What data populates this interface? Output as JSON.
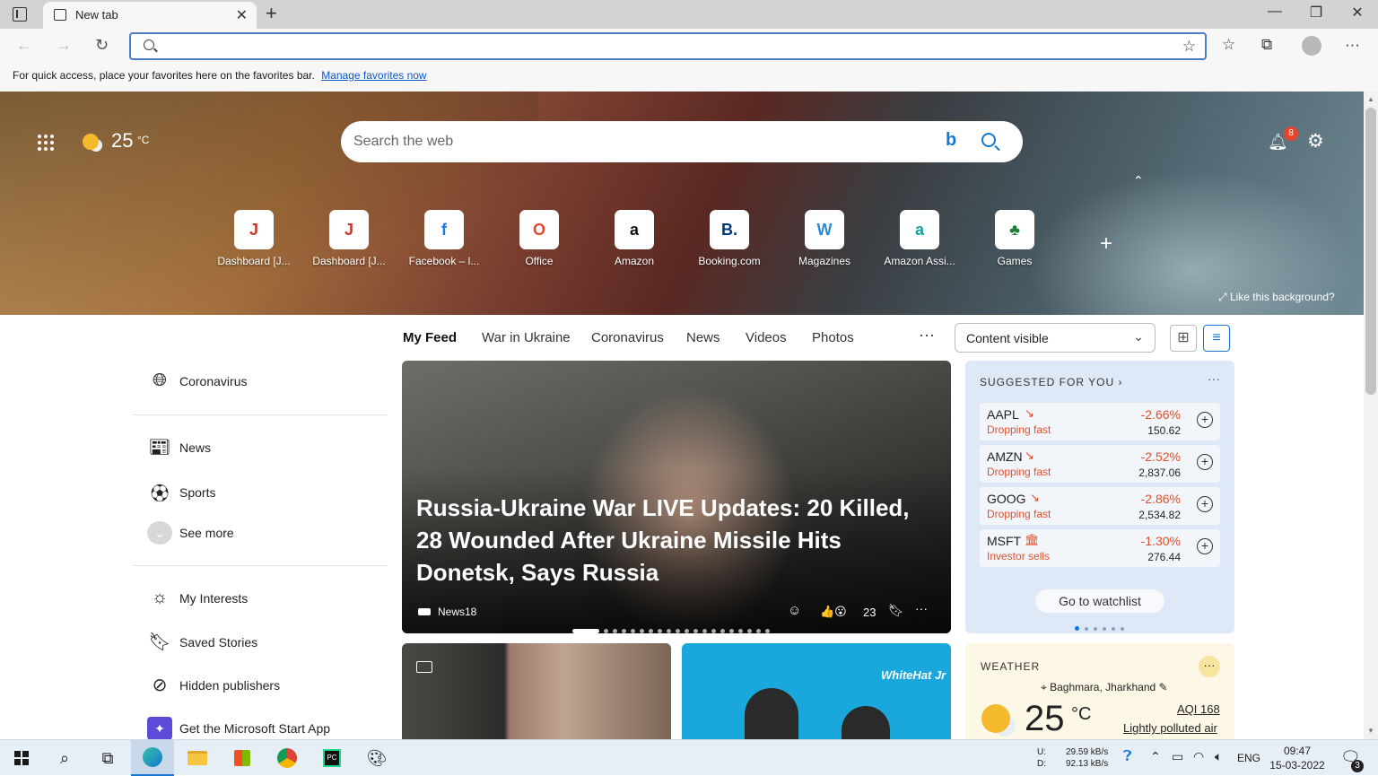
{
  "browser": {
    "tab_title": "New tab",
    "address_value": "",
    "favorites_bar_text": "For quick access, place your favorites here on the favorites bar.",
    "favorites_bar_link": "Manage favorites now"
  },
  "hero": {
    "weather_temp": "25",
    "weather_unit": "°C",
    "search_placeholder": "Search the web",
    "bing_logo": "b",
    "notification_count": "8",
    "like_background": "Like this background?",
    "quick_links": [
      {
        "label": "Dashboard [J...",
        "icon": "jenkins-icon",
        "glyph": "J",
        "color": "#c0392b"
      },
      {
        "label": "Dashboard [J...",
        "icon": "jenkins-icon",
        "glyph": "J",
        "color": "#c0392b"
      },
      {
        "label": "Facebook – l...",
        "icon": "facebook-icon",
        "glyph": "f",
        "color": "#1877f2"
      },
      {
        "label": "Office",
        "icon": "office-icon",
        "glyph": "O",
        "color": "#e8452d"
      },
      {
        "label": "Amazon",
        "icon": "amazon-icon",
        "glyph": "a",
        "color": "#111111"
      },
      {
        "label": "Booking.com",
        "icon": "booking-icon",
        "glyph": "B.",
        "color": "#003580"
      },
      {
        "label": "Magazines",
        "icon": "magazines-icon",
        "glyph": "W",
        "color": "#2e8bd8"
      },
      {
        "label": "Amazon Assi...",
        "icon": "amazon-assistant-icon",
        "glyph": "a",
        "color": "#13a39a"
      },
      {
        "label": "Games",
        "icon": "games-icon",
        "glyph": "♣",
        "color": "#1e7e34"
      }
    ]
  },
  "feed_nav": {
    "tabs": [
      "My Feed",
      "War in Ukraine",
      "Coronavirus",
      "News",
      "Videos",
      "Photos"
    ],
    "more": "···",
    "content_visibility": "Content visible"
  },
  "sidebar": {
    "items": [
      {
        "label": "Coronavirus",
        "icon": "globe-icon"
      },
      {
        "label": "News",
        "icon": "newspaper-icon"
      },
      {
        "label": "Sports",
        "icon": "sports-ball-icon"
      },
      {
        "label": "See more",
        "icon": "chevron-down-icon"
      },
      {
        "label": "My Interests",
        "icon": "sun-icon"
      },
      {
        "label": "Saved Stories",
        "icon": "bookmark-icon"
      },
      {
        "label": "Hidden publishers",
        "icon": "block-icon"
      },
      {
        "label": "Get the Microsoft Start App",
        "icon": "microsoft-start-icon"
      }
    ]
  },
  "hero_card": {
    "headline": "Russia-Ukraine War LIVE Updates: 20 Killed, 28 Wounded After Ukraine Missile Hits Donetsk, Says Russia",
    "source": "News18",
    "reaction_count": "23"
  },
  "stocks": {
    "header": "SUGGESTED FOR YOU",
    "items": [
      {
        "symbol": "AAPL",
        "status": "Dropping fast",
        "change": "-2.66%",
        "price": "150.62"
      },
      {
        "symbol": "AMZN",
        "status": "Dropping fast",
        "change": "-2.52%",
        "price": "2,837.06"
      },
      {
        "symbol": "GOOG",
        "status": "Dropping fast",
        "change": "-2.86%",
        "price": "2,534.82"
      },
      {
        "symbol": "MSFT",
        "status": "Investor sells",
        "change": "-1.30%",
        "price": "276.44"
      }
    ],
    "watchlist_button": "Go to watchlist"
  },
  "weather_card": {
    "header": "WEATHER",
    "location": "Baghmara, Jharkhand",
    "temp": "25",
    "unit": "°C",
    "aqi": "AQI 168",
    "air_quality": "Lightly polluted air"
  },
  "card3": {
    "brand": "WhiteHat Jr"
  },
  "taskbar": {
    "upload_label": "U:",
    "download_label": "D:",
    "upload_speed": "29.59 kB/s",
    "download_speed": "92.13 kB/s",
    "language": "ENG",
    "time": "09:47",
    "date": "15-03-2022",
    "notification_count": "3"
  },
  "colors": {
    "accent": "#1677d2",
    "stock_down": "#e04f2a"
  }
}
